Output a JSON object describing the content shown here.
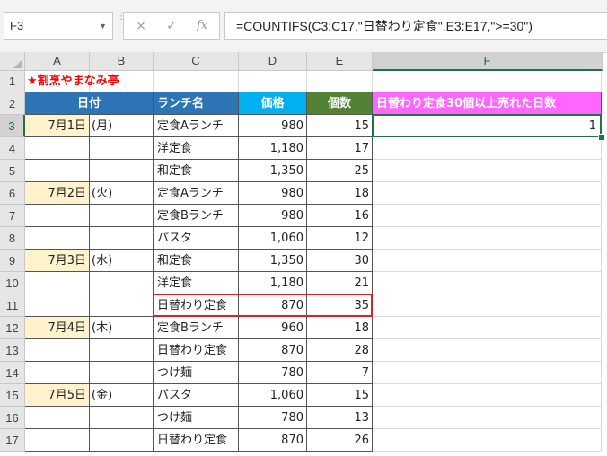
{
  "name_box": "F3",
  "formula_bar": {
    "cancel_icon": "×",
    "enter_icon": "✓",
    "function_icon": "fx",
    "formula": "=COUNTIFS(C3:C17,\"日替わり定食\",E3:E17,\">=30\")"
  },
  "columns": [
    "A",
    "B",
    "C",
    "D",
    "E",
    "F"
  ],
  "rows": [
    "1",
    "2",
    "3",
    "4",
    "5",
    "6",
    "7",
    "8",
    "9",
    "10",
    "11",
    "12",
    "13",
    "14",
    "15",
    "16",
    "17"
  ],
  "sheet": {
    "title": "★割烹やまなみ亭",
    "headers": {
      "date": "日付",
      "lunch": "ランチ名",
      "price": "価格",
      "qty": "個数",
      "result": "日替わり定食30個以上売れた日数"
    },
    "result_value": "1",
    "data": [
      {
        "date": "7月1日",
        "dow": "(月)",
        "name": "定食Aランチ",
        "price": "980",
        "qty": "15"
      },
      {
        "date": "",
        "dow": "",
        "name": "洋定食",
        "price": "1,180",
        "qty": "17"
      },
      {
        "date": "",
        "dow": "",
        "name": "和定食",
        "price": "1,350",
        "qty": "25"
      },
      {
        "date": "7月2日",
        "dow": "(火)",
        "name": "定食Aランチ",
        "price": "980",
        "qty": "18"
      },
      {
        "date": "",
        "dow": "",
        "name": "定食Bランチ",
        "price": "980",
        "qty": "16"
      },
      {
        "date": "",
        "dow": "",
        "name": "パスタ",
        "price": "1,060",
        "qty": "12"
      },
      {
        "date": "7月3日",
        "dow": "(水)",
        "name": "和定食",
        "price": "1,350",
        "qty": "30"
      },
      {
        "date": "",
        "dow": "",
        "name": "洋定食",
        "price": "1,180",
        "qty": "21"
      },
      {
        "date": "",
        "dow": "",
        "name": "日替わり定食",
        "price": "870",
        "qty": "35"
      },
      {
        "date": "7月4日",
        "dow": "(木)",
        "name": "定食Bランチ",
        "price": "960",
        "qty": "18"
      },
      {
        "date": "",
        "dow": "",
        "name": "日替わり定食",
        "price": "870",
        "qty": "28"
      },
      {
        "date": "",
        "dow": "",
        "name": "つけ麺",
        "price": "780",
        "qty": "7"
      },
      {
        "date": "7月5日",
        "dow": "(金)",
        "name": "パスタ",
        "price": "1,060",
        "qty": "15"
      },
      {
        "date": "",
        "dow": "",
        "name": "つけ麺",
        "price": "780",
        "qty": "13"
      },
      {
        "date": "",
        "dow": "",
        "name": "日替わり定食",
        "price": "870",
        "qty": "26"
      }
    ]
  },
  "colors": {
    "header_blue": "#2e75b6",
    "header_green": "#548235",
    "header_cyan": "#00b0f0",
    "header_pink": "#ff66ff",
    "date_fill": "#fff2cc",
    "title_red": "#ff0000",
    "highlight_red": "#e02020",
    "selection_green": "#217346"
  }
}
